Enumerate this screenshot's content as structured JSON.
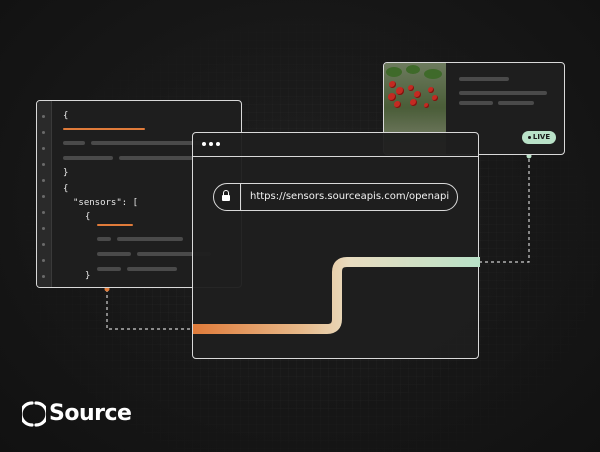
{
  "code_panel": {
    "line_open_brace": "{",
    "line_close_brace": "}",
    "line_open_brace_2": "{",
    "line_sensors": "\"sensors\": [",
    "line_inner_brace": "{",
    "line_inner_close": "}"
  },
  "browser": {
    "url": "https://sensors.sourceapis.com/openapi"
  },
  "live_badge": {
    "label": "LIVE"
  },
  "brand": {
    "name": "Source"
  },
  "colors": {
    "accent_orange": "#e07b3a",
    "accent_mint": "#b9e2c8",
    "background": "#161616"
  },
  "icons": [
    "lock-icon",
    "source-logo-icon",
    "window-dots-icon"
  ]
}
